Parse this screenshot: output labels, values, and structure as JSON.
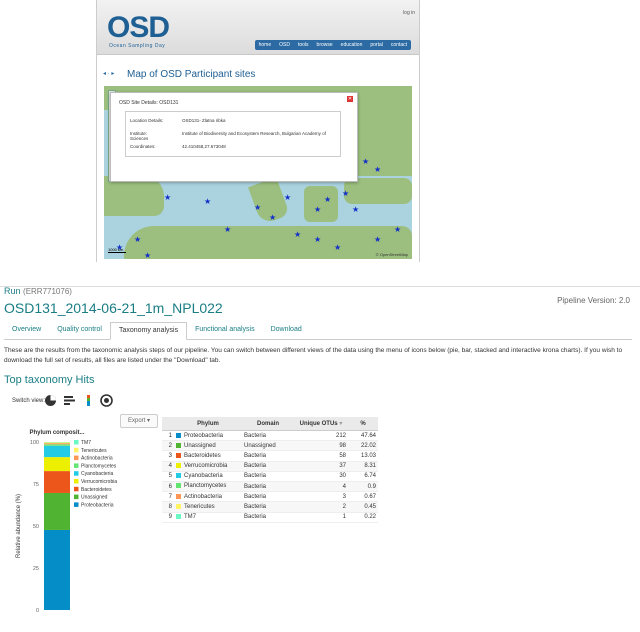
{
  "osd_site": {
    "logo": "OSD",
    "logo_sub": "Ocean Sampling Day",
    "login": "log in",
    "nav": [
      "home",
      "OSD",
      "tools",
      "browse",
      "education",
      "portal",
      "contact"
    ],
    "title_arrows": "◂ · ▸",
    "map_title": "Map of OSD Participant sites",
    "popup": {
      "title": "OSD Site Details: OSD131",
      "close": "✕",
      "rows": [
        {
          "label": "Location Details:",
          "value": "OSD131- Zlatna ribka"
        },
        {
          "label": "Institute:",
          "value": "Institute of Biodiversity and Ecosystem Research, Bulgarian Academy of Sciences"
        },
        {
          "label": "Coordinates:",
          "value": "42.410458,27.673048"
        }
      ]
    },
    "map_credit": "© OpenStreetMap",
    "map_scale": "1000 km"
  },
  "run": {
    "label": "Run",
    "accession": "(ERR771076)",
    "title": "OSD131_2014-06-21_1m_NPL022",
    "pipeline": "Pipeline Version: 2.0"
  },
  "tabs": [
    {
      "label": "Overview",
      "active": false
    },
    {
      "label": "Quality control",
      "active": false
    },
    {
      "label": "Taxonomy analysis",
      "active": true
    },
    {
      "label": "Functional analysis",
      "active": false
    },
    {
      "label": "Download",
      "active": false
    }
  ],
  "description": "These are the results from the taxonomic analysis steps of our pipeline. You can switch between different views of the data using the menu of icons below (pie, bar, stacked and interactive krona charts). If you wish to download the full set of results, all files are listed under the \"Download\" tab.",
  "section_title": "Top taxonomy Hits",
  "switch_view_label": "Switch view:",
  "switch_icons": [
    "pie-chart-icon",
    "bar-chart-icon",
    "stacked-bar-icon",
    "krona-chart-icon"
  ],
  "export_label": "Export",
  "table": {
    "headers": [
      "Phylum",
      "Domain",
      "Unique OTUs",
      "%"
    ],
    "rows": [
      {
        "idx": "1",
        "phylum": "Proteobacteria",
        "domain": "Bacteria",
        "otus": "212",
        "pct": "47.64",
        "color": "#058dc7"
      },
      {
        "idx": "2",
        "phylum": "Unassigned",
        "domain": "Unassigned",
        "otus": "98",
        "pct": "22.02",
        "color": "#50b432"
      },
      {
        "idx": "3",
        "phylum": "Bacteroidetes",
        "domain": "Bacteria",
        "otus": "58",
        "pct": "13.03",
        "color": "#ed561b"
      },
      {
        "idx": "4",
        "phylum": "Verrucomicrobia",
        "domain": "Bacteria",
        "otus": "37",
        "pct": "8.31",
        "color": "#edef00"
      },
      {
        "idx": "5",
        "phylum": "Cyanobacteria",
        "domain": "Bacteria",
        "otus": "30",
        "pct": "6.74",
        "color": "#24cbe5"
      },
      {
        "idx": "6",
        "phylum": "Planctomycetes",
        "domain": "Bacteria",
        "otus": "4",
        "pct": "0.9",
        "color": "#64e572"
      },
      {
        "idx": "7",
        "phylum": "Actinobacteria",
        "domain": "Bacteria",
        "otus": "3",
        "pct": "0.67",
        "color": "#ff9655"
      },
      {
        "idx": "8",
        "phylum": "Tenericutes",
        "domain": "Bacteria",
        "otus": "2",
        "pct": "0.45",
        "color": "#fff263"
      },
      {
        "idx": "9",
        "phylum": "TM7",
        "domain": "Bacteria",
        "otus": "1",
        "pct": "0.22",
        "color": "#6af9c4"
      }
    ]
  },
  "chart_data": {
    "type": "bar",
    "title": "Phylum composit...",
    "ylabel": "Relative abundance (%)",
    "ylim": [
      0,
      100
    ],
    "yticks": [
      0,
      25,
      50,
      75,
      100
    ],
    "legend_placement": "right",
    "series": [
      {
        "name": "Proteobacteria",
        "value": 47.64,
        "color": "#058dc7"
      },
      {
        "name": "Unassigned",
        "value": 22.02,
        "color": "#50b432"
      },
      {
        "name": "Bacteroidetes",
        "value": 13.03,
        "color": "#ed561b"
      },
      {
        "name": "Verrucomicrobia",
        "value": 8.31,
        "color": "#edef00"
      },
      {
        "name": "Cyanobacteria",
        "value": 6.74,
        "color": "#24cbe5"
      },
      {
        "name": "Planctomycetes",
        "value": 0.9,
        "color": "#64e572"
      },
      {
        "name": "Actinobacteria",
        "value": 0.67,
        "color": "#ff9655"
      },
      {
        "name": "Tenericutes",
        "value": 0.45,
        "color": "#fff263"
      },
      {
        "name": "TM7",
        "value": 0.22,
        "color": "#6af9c4"
      }
    ],
    "legend_order": [
      "TM7",
      "Tenericutes",
      "Actinobacteria",
      "Planctomycetes",
      "Cyanobacteria",
      "Verrucomicrobia",
      "Bacteroidetes",
      "Unassigned",
      "Proteobacteria"
    ]
  }
}
